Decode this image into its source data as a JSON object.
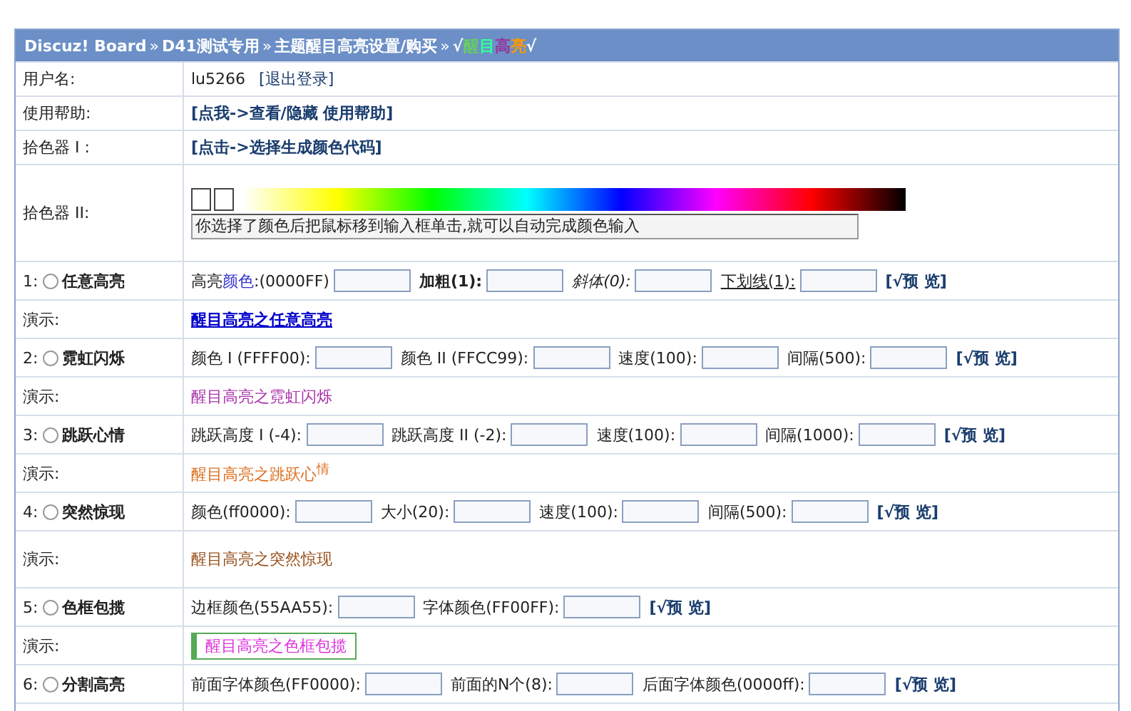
{
  "breadcrumb": {
    "items": [
      {
        "text": "Discuz! Board"
      },
      {
        "text": "D41测试专用"
      },
      {
        "text": "主题醒目高亮设置/购买"
      }
    ],
    "separator": "»",
    "title_chars": [
      {
        "text": "√",
        "color": "#ffffff"
      },
      {
        "text": "醒",
        "color": "#66cc66"
      },
      {
        "text": "目",
        "color": "#33ff99"
      },
      {
        "text": "高",
        "color": "#993399"
      },
      {
        "text": "亮",
        "color": "#ff9900"
      },
      {
        "text": "√",
        "color": "#ffffff"
      }
    ]
  },
  "account": {
    "label": "用户名:",
    "username": "lu5266",
    "logout": "[退出登录]"
  },
  "help": {
    "label": "使用帮助:",
    "link": "[点我->查看/隐藏 使用帮助]"
  },
  "picker1": {
    "label": "拾色器 I :",
    "link": "[点击->选择生成颜色代码]"
  },
  "picker2": {
    "label": "拾色器 II:",
    "value": "你选择了颜色后把鼠标移到输入框单击,就可以自动完成颜色输入"
  },
  "options": [
    {
      "number": "1:",
      "name": "任意高亮",
      "selected": false,
      "preview": "[√预 览]",
      "fields": [
        {
          "kind": "plain",
          "parts": [
            {
              "text": "高亮"
            },
            {
              "text": "颜色",
              "color": "#3333cc"
            },
            {
              "text": ":(0000FF)"
            }
          ]
        },
        {
          "kind": "bold",
          "parts": [
            {
              "text": "加粗(1)"
            },
            {
              "text": ":"
            }
          ]
        },
        {
          "kind": "italic",
          "parts": [
            {
              "text": "斜体(0)"
            },
            {
              "text": ":"
            }
          ]
        },
        {
          "kind": "underline",
          "parts": [
            {
              "text": "下划线(1)"
            },
            {
              "text": ":"
            }
          ]
        }
      ],
      "demo_label": "演示:",
      "demo": {
        "kind": "link",
        "text": "醒目高亮之任意高亮",
        "color": "#0000cc"
      }
    },
    {
      "number": "2:",
      "name": "霓虹闪烁",
      "selected": false,
      "preview": "[√预 览]",
      "fields": [
        {
          "kind": "plain",
          "parts": [
            {
              "text": "颜色 I (FFFF00):"
            }
          ]
        },
        {
          "kind": "plain",
          "parts": [
            {
              "text": "颜色 II (FFCC99):"
            }
          ]
        },
        {
          "kind": "plain",
          "parts": [
            {
              "text": "速度(100):"
            }
          ]
        },
        {
          "kind": "plain",
          "parts": [
            {
              "text": "间隔(500):"
            }
          ]
        }
      ],
      "demo_label": "演示:",
      "demo": {
        "kind": "text",
        "text": "醒目高亮之霓虹闪烁",
        "color": "#aa33aa"
      }
    },
    {
      "number": "3:",
      "name": "跳跃心情",
      "selected": false,
      "preview": "[√预 览]",
      "fields": [
        {
          "kind": "plain",
          "parts": [
            {
              "text": "跳跃高度 I (-4):"
            }
          ]
        },
        {
          "kind": "plain",
          "parts": [
            {
              "text": "跳跃高度 II (-2):"
            }
          ]
        },
        {
          "kind": "plain",
          "parts": [
            {
              "text": "速度(100):"
            }
          ]
        },
        {
          "kind": "plain",
          "parts": [
            {
              "text": "间隔(1000):"
            }
          ]
        }
      ],
      "demo_label": "演示:",
      "demo": {
        "kind": "text",
        "text": "醒目高亮之跳跃心$^{情}$",
        "color": "#dd6f1f"
      }
    },
    {
      "number": "4:",
      "name": "突然惊现",
      "selected": false,
      "preview": "[√预 览]",
      "fields": [
        {
          "kind": "plain",
          "parts": [
            {
              "text": "颜色(ff0000):"
            }
          ]
        },
        {
          "kind": "plain",
          "parts": [
            {
              "text": "大小(20):"
            }
          ]
        },
        {
          "kind": "plain",
          "parts": [
            {
              "text": "速度(100):"
            }
          ]
        },
        {
          "kind": "plain",
          "parts": [
            {
              "text": "间隔(500):"
            }
          ]
        }
      ],
      "demo_label": "演示:",
      "demo": {
        "kind": "text",
        "text": "醒目高亮之突然惊现",
        "color": "#99521f"
      }
    },
    {
      "number": "5:",
      "name": "色框包揽",
      "selected": false,
      "preview": "[√预 览]",
      "fields": [
        {
          "kind": "plain",
          "parts": [
            {
              "text": "边框颜色(55AA55):"
            }
          ]
        },
        {
          "kind": "plain",
          "parts": [
            {
              "text": "字体颜色(FF00FF):"
            }
          ]
        }
      ],
      "demo_label": "演示:",
      "demo": {
        "kind": "framed",
        "text": "醒目高亮之色框包揽",
        "color": "#dd33dd"
      }
    },
    {
      "number": "6:",
      "name": "分割高亮",
      "selected": false,
      "preview": "[√预 览]",
      "fields": [
        {
          "kind": "plain",
          "parts": [
            {
              "text": "前面字体颜色(FF0000):"
            }
          ]
        },
        {
          "kind": "plain",
          "parts": [
            {
              "text": "前面的N个(8):"
            }
          ]
        },
        {
          "kind": "plain",
          "parts": [
            {
              "text": "后面字体颜色(0000ff):"
            }
          ]
        }
      ]
    }
  ]
}
